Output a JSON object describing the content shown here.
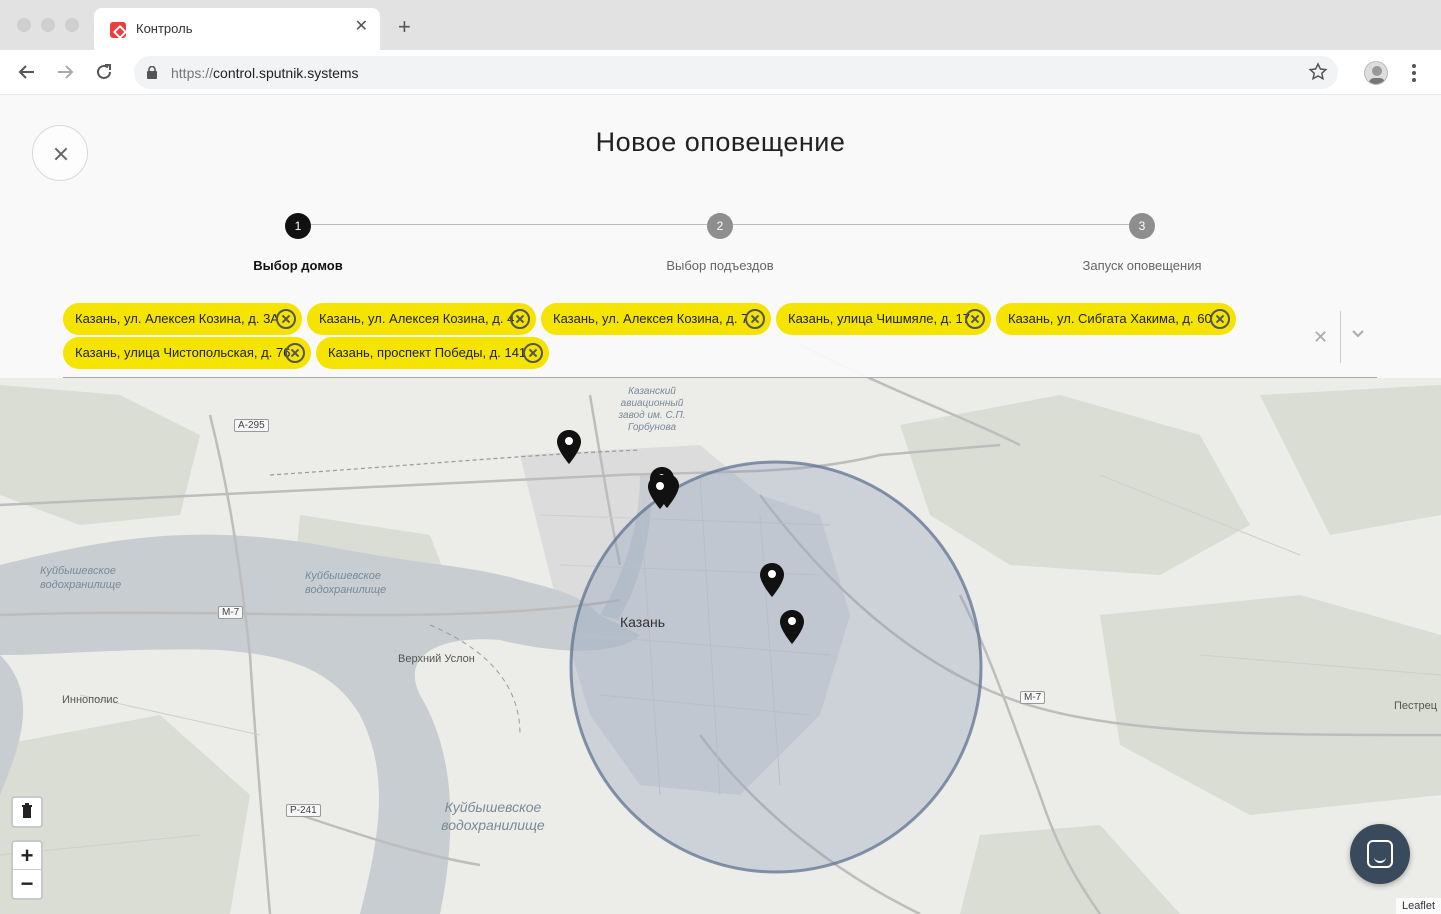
{
  "browser": {
    "tab_title": "Контроль",
    "url_protocol": "https://",
    "url_host": "control.sputnik.systems"
  },
  "page": {
    "title": "Новое оповещение"
  },
  "steps": [
    {
      "number": "1",
      "label": "Выбор домов",
      "state": "active"
    },
    {
      "number": "2",
      "label": "Выбор подъездов",
      "state": "inactive"
    },
    {
      "number": "3",
      "label": "Запуск оповещения",
      "state": "inactive"
    }
  ],
  "selected_houses": [
    "Казань, ул. Алексея Козина, д. 3А",
    "Казань, ул. Алексея Козина, д. 4",
    "Казань, ул. Алексея Козина, д. 7",
    "Казань, улица Чишмяле, д. 17",
    "Казань, ул. Сибгата Хакима, д. 60",
    "Казань, улица Чистопольская, д. 76",
    "Казань, проспект Победы, д. 141"
  ],
  "map": {
    "city_label": "Казань",
    "labels": {
      "factory": "Казанский авиационный завод им. С.П. Горбунова",
      "reservoir_left": "Куйбышевское водохранилище",
      "reservoir_mid": "Куйбышевское водохранилище",
      "reservoir_bottom": "Куйбышевское водохранилище",
      "verkhny_uslon": "Верхний Услон",
      "innopolis": "Иннополис",
      "pestrec": "Пестрец"
    },
    "roads": {
      "a295": "А-295",
      "m7_left": "М-7",
      "m7_right": "М-7",
      "r241": "Р-241"
    },
    "zoom_in": "+",
    "zoom_out": "−",
    "attribution": "Leaflet",
    "colors": {
      "circle_fill": "#8a9cb8",
      "circle_stroke": "#5f7391",
      "chip": "#f5e400",
      "step_active": "#111111",
      "step_inactive": "#8e8e8e"
    }
  },
  "icons": [
    "close-icon",
    "trash-icon",
    "chat-icon",
    "map-pin-icon",
    "chevron-down-icon",
    "star-icon",
    "lock-icon"
  ]
}
